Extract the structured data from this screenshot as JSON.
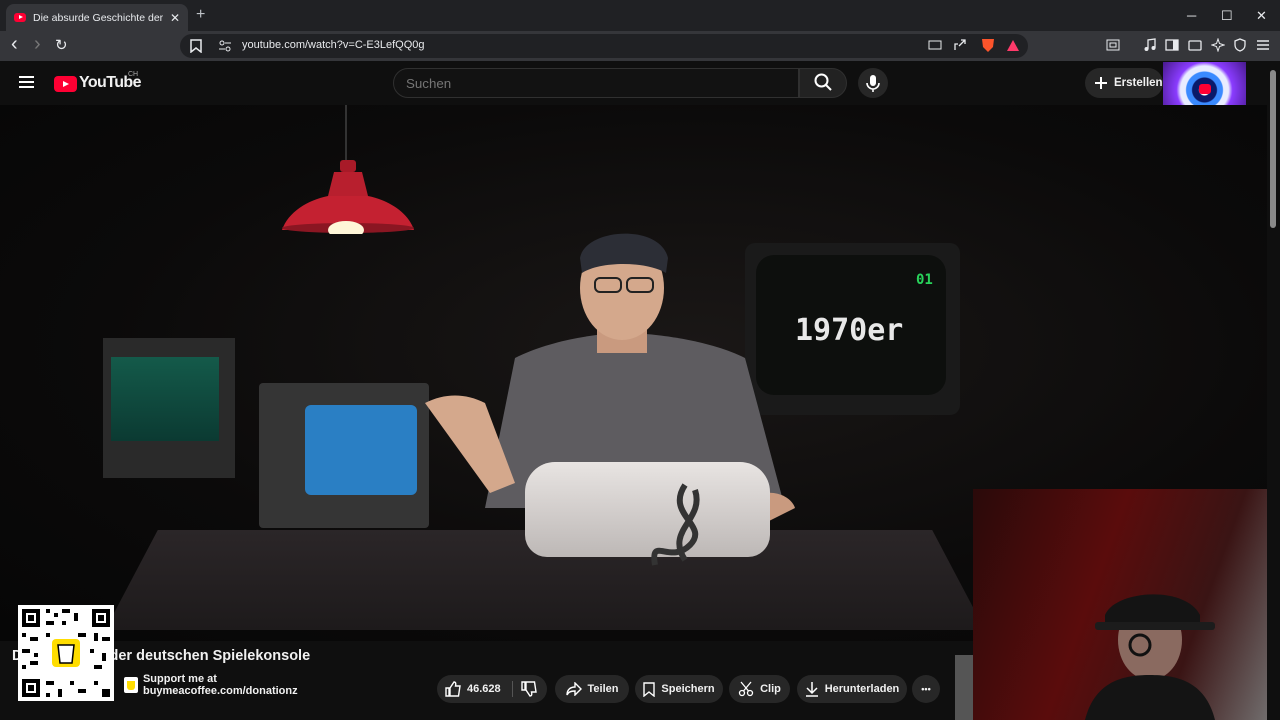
{
  "browser": {
    "tab_title": "Die absurde Geschichte der deut",
    "tab_close": "✕",
    "new_tab": "+",
    "url": "youtube.com/watch?v=C-E3LefQQ0g",
    "window_controls": [
      "─",
      "☐",
      "✕"
    ],
    "nav": {
      "back": "‹",
      "forward": "›",
      "reload": "↻"
    }
  },
  "header": {
    "logo_text": "YouTube",
    "country_code": "CH",
    "search_placeholder": "Suchen",
    "create_label": "Erstellen"
  },
  "video": {
    "tv_text": "1970er",
    "tv_counter": "01",
    "title": "Die absurde Geschichte der deutschen Spielekonsole",
    "title_visible": "D      schichte der deutschen Spielekonsole"
  },
  "overlay": {
    "support_text": "Support me at buymeacoffee.com/donationz"
  },
  "actions": {
    "like_count": "46.628",
    "share": "Teilen",
    "save": "Speichern",
    "clip": "Clip",
    "download": "Herunterladen",
    "more": "•••"
  },
  "colors": {
    "brand_red": "#ff0033",
    "background": "#0f0f0f",
    "pill_bg": "#272727"
  }
}
